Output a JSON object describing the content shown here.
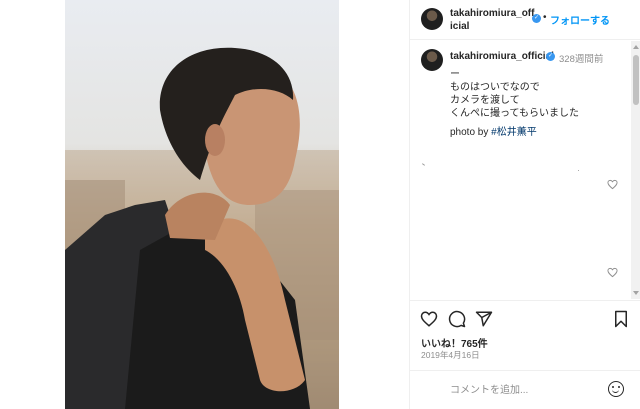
{
  "post": {
    "username": "takahiromiura_official",
    "follow_label": "フォローする",
    "separator": "•",
    "verified_icon": "verified-badge-icon"
  },
  "caption": {
    "username": "takahiromiura_official",
    "time_ago": "328週間前",
    "text": "ー\nものはついでなので\nカメラを渡して\nくんぺに撮ってもらいました",
    "credit_prefix": "photo by",
    "credit_tag": "#松井薫平"
  },
  "actions": {
    "icons": [
      "heart-icon",
      "comment-icon",
      "share-icon",
      "bookmark-icon"
    ],
    "likes": "いいね！765件",
    "date": "2019年4月16日"
  },
  "comment_input": {
    "placeholder": "コメントを追加...",
    "value": ""
  },
  "colors": {
    "accent": "#0095f6",
    "verified": "#3897f0",
    "muted": "#8e8e8e"
  }
}
